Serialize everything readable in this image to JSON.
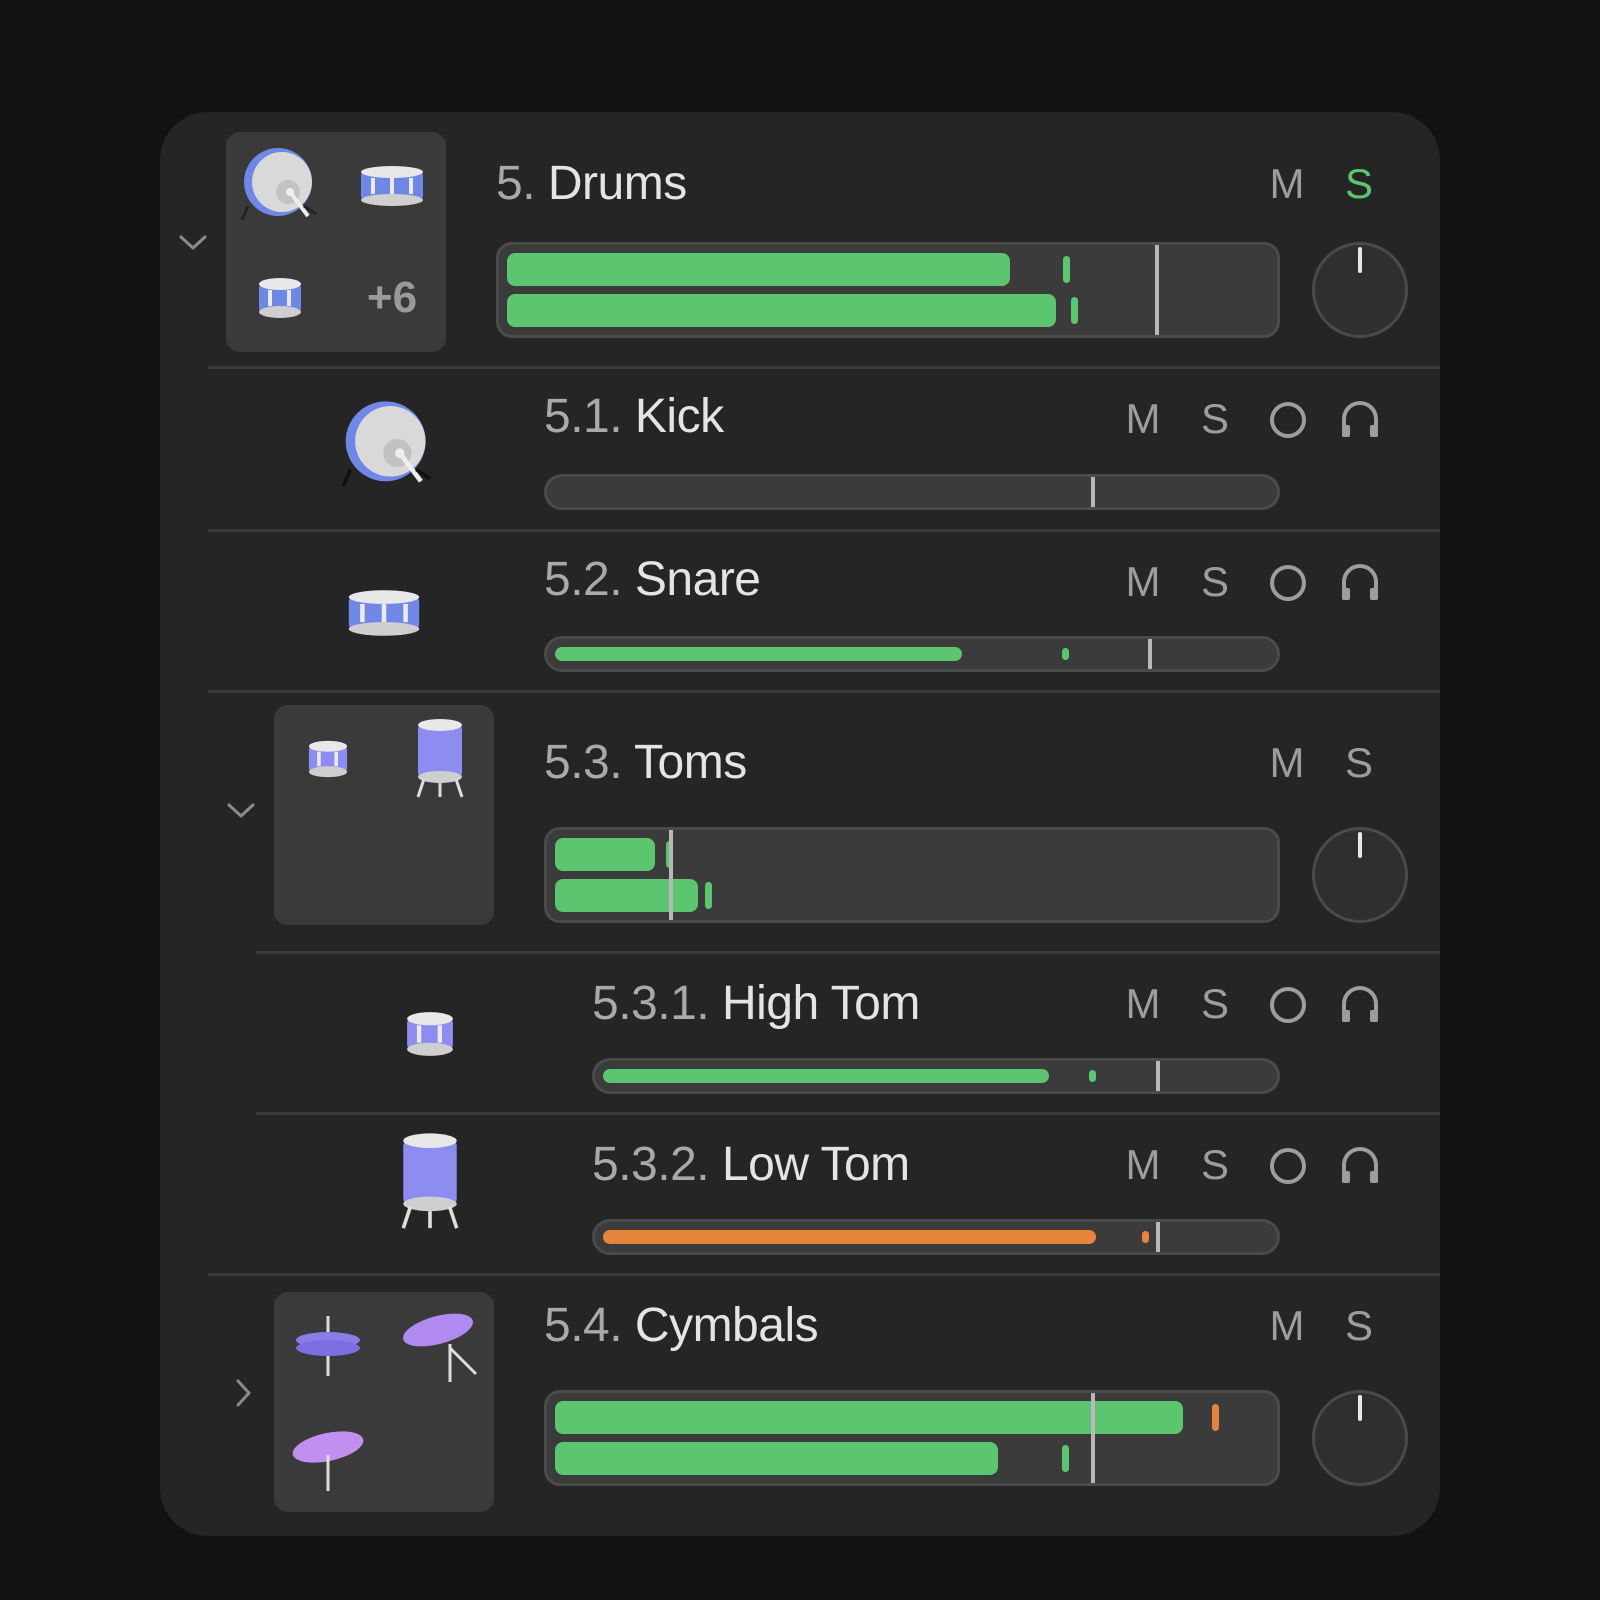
{
  "colors": {
    "green": "#5cc56f",
    "orange": "#e6833c",
    "solo_active": "#5cc56f",
    "drum_blue": "#7d8df0",
    "cymbal_purple": "#a98af0"
  },
  "tracks": [
    {
      "id": "drums",
      "number": "5.",
      "name": "Drums",
      "expanded": true,
      "mute": "M",
      "solo": "S",
      "solo_active": true,
      "more_label": "+6",
      "icons": [
        "kick-drum-icon",
        "snare-drum-icon",
        "snare-drum-icon",
        "more-count"
      ],
      "meter": {
        "type": "stereo",
        "levels": [
          0.66,
          0.72
        ],
        "peaks": [
          0.73,
          0.74
        ],
        "fader": 0.85,
        "color": "green"
      },
      "knob": "pan-knob"
    },
    {
      "id": "kick",
      "number": "5.1.",
      "name": "Kick",
      "mute": "M",
      "solo": "S",
      "record": "O",
      "monitor": "headphones-icon",
      "meter": {
        "type": "mono",
        "levels": [
          0
        ],
        "peaks": [],
        "fader": 0.75,
        "color": "green"
      }
    },
    {
      "id": "snare",
      "number": "5.2.",
      "name": "Snare",
      "mute": "M",
      "solo": "S",
      "record": "O",
      "monitor": "headphones-icon",
      "meter": {
        "type": "mono",
        "levels": [
          0.57
        ],
        "peaks": [
          0.71
        ],
        "fader": 0.83,
        "color": "green"
      }
    },
    {
      "id": "toms",
      "number": "5.3.",
      "name": "Toms",
      "expanded": true,
      "mute": "M",
      "solo": "S",
      "icons": [
        "high-tom-icon",
        "floor-tom-icon",
        "",
        ""
      ],
      "meter": {
        "type": "stereo",
        "levels": [
          0.14,
          0.2
        ],
        "peaks": [
          0.155,
          0.21
        ],
        "fader": 0.16,
        "color": "green"
      },
      "knob": "pan-knob"
    },
    {
      "id": "hightom",
      "number": "5.3.1.",
      "name": "High Tom",
      "mute": "M",
      "solo": "S",
      "record": "O",
      "monitor": "headphones-icon",
      "meter": {
        "type": "mono",
        "levels": [
          0.67
        ],
        "peaks": [
          0.73
        ],
        "fader": 0.83,
        "color": "green"
      }
    },
    {
      "id": "lowtom",
      "number": "5.3.2.",
      "name": "Low Tom",
      "mute": "M",
      "solo": "S",
      "record": "O",
      "monitor": "headphones-icon",
      "meter": {
        "type": "mono",
        "levels": [
          0.74
        ],
        "peaks": [
          0.81
        ],
        "fader": 0.83,
        "color": "orange"
      }
    },
    {
      "id": "cymbals",
      "number": "5.4.",
      "name": "Cymbals",
      "expanded": false,
      "mute": "M",
      "solo": "S",
      "icons": [
        "hihat-icon",
        "crash-cymbal-icon",
        "ride-cymbal-icon",
        ""
      ],
      "meter": {
        "type": "stereo",
        "levels": [
          0.88,
          0.62
        ],
        "peaks": [
          0.92,
          0.71
        ],
        "fader": 0.75,
        "color": "green",
        "peak_colors": [
          "orange",
          "green"
        ]
      },
      "knob": "pan-knob"
    }
  ]
}
